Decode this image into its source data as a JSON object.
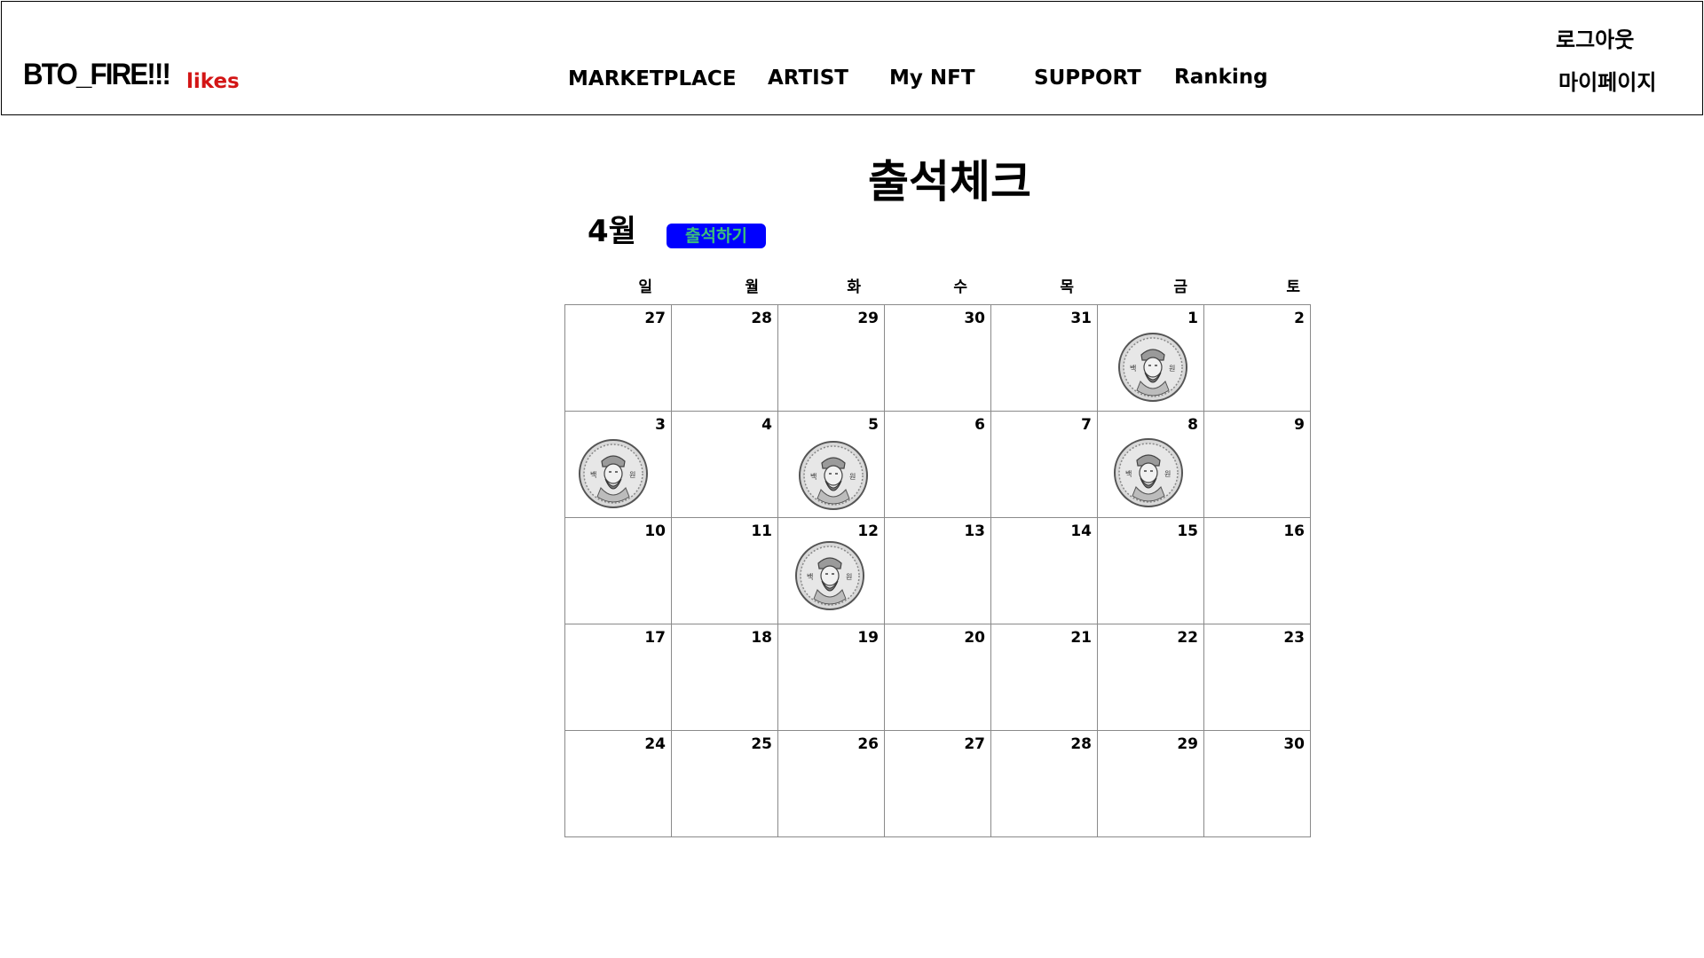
{
  "header": {
    "brand": "BTO_FIRE!!!",
    "brand_sub": "likes",
    "nav": [
      "MARKETPLACE",
      "ARTIST",
      "My NFT",
      "SUPPORT",
      "Ranking"
    ],
    "logout": "로그아웃",
    "mypage": "마이페이지"
  },
  "main": {
    "title": "출석체크",
    "month": "4월",
    "check_button": "출석하기"
  },
  "calendar": {
    "weekdays": [
      "일",
      "월",
      "화",
      "수",
      "목",
      "금",
      "토"
    ],
    "weeks": [
      [
        {
          "day": "27",
          "stamp": false
        },
        {
          "day": "28",
          "stamp": false
        },
        {
          "day": "29",
          "stamp": false
        },
        {
          "day": "30",
          "stamp": false
        },
        {
          "day": "31",
          "stamp": false
        },
        {
          "day": "1",
          "stamp": true
        },
        {
          "day": "2",
          "stamp": false
        }
      ],
      [
        {
          "day": "3",
          "stamp": true
        },
        {
          "day": "4",
          "stamp": false
        },
        {
          "day": "5",
          "stamp": true
        },
        {
          "day": "6",
          "stamp": false
        },
        {
          "day": "7",
          "stamp": false
        },
        {
          "day": "8",
          "stamp": true
        },
        {
          "day": "9",
          "stamp": false
        }
      ],
      [
        {
          "day": "10",
          "stamp": false
        },
        {
          "day": "11",
          "stamp": false
        },
        {
          "day": "12",
          "stamp": true
        },
        {
          "day": "13",
          "stamp": false
        },
        {
          "day": "14",
          "stamp": false
        },
        {
          "day": "15",
          "stamp": false
        },
        {
          "day": "16",
          "stamp": false
        }
      ],
      [
        {
          "day": "17",
          "stamp": false
        },
        {
          "day": "18",
          "stamp": false
        },
        {
          "day": "19",
          "stamp": false
        },
        {
          "day": "20",
          "stamp": false
        },
        {
          "day": "21",
          "stamp": false
        },
        {
          "day": "22",
          "stamp": false
        },
        {
          "day": "23",
          "stamp": false
        }
      ],
      [
        {
          "day": "24",
          "stamp": false
        },
        {
          "day": "25",
          "stamp": false
        },
        {
          "day": "26",
          "stamp": false
        },
        {
          "day": "27",
          "stamp": false
        },
        {
          "day": "28",
          "stamp": false
        },
        {
          "day": "29",
          "stamp": false
        },
        {
          "day": "30",
          "stamp": false
        }
      ]
    ],
    "stamp_icon": "100-won-coin-icon",
    "stamp_text": "백 원"
  },
  "colors": {
    "brand_sub": "#d31515",
    "button_bg": "#0000ff",
    "button_text": "#3cc07a",
    "grid_line": "#8a8a8a"
  }
}
